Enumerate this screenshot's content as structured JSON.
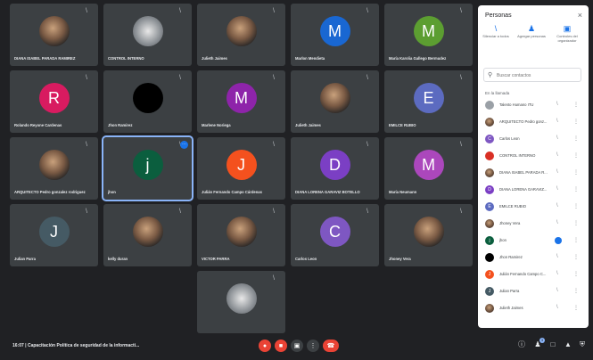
{
  "participants_grid": [
    {
      "name": "DIANA ISABEL PARADA RAMIREZ",
      "avatar": "",
      "kind": "photo",
      "color": ""
    },
    {
      "name": "CONTROL INTERNO",
      "avatar": "",
      "kind": "logo",
      "color": ""
    },
    {
      "name": "Julieth Jaimes",
      "avatar": "",
      "kind": "photo",
      "color": ""
    },
    {
      "name": "Marlon Mendieta",
      "avatar": "M",
      "kind": "letter",
      "color": "#1967d2"
    },
    {
      "name": "María Karolia Gallego Bermudez",
      "avatar": "M",
      "kind": "letter",
      "color": "#5c9e31"
    },
    {
      "name": "Rolando Reyone Cardenas",
      "avatar": "R",
      "kind": "letter",
      "color": "#d81b60"
    },
    {
      "name": "Jhon Ramirez",
      "avatar": "",
      "kind": "dark",
      "color": "#000000"
    },
    {
      "name": "Marlene Noriega",
      "avatar": "M",
      "kind": "letter",
      "color": "#8e24aa"
    },
    {
      "name": "Julieth Jaimes",
      "avatar": "",
      "kind": "photo",
      "color": ""
    },
    {
      "name": "EMILCE RUBIO",
      "avatar": "E",
      "kind": "letter",
      "color": "#5c6bc0"
    },
    {
      "name": "ARQUITECTO Pedro gonzalez rodriguez",
      "avatar": "",
      "kind": "photo",
      "color": ""
    },
    {
      "name": "jhon",
      "avatar": "j",
      "kind": "letter",
      "color": "#0b5e3e"
    },
    {
      "name": "Julián Fernando Campo Cárdenas",
      "avatar": "J",
      "kind": "letter",
      "color": "#f4511e"
    },
    {
      "name": "DIANA LORENA GARAVIZ BOTELLO",
      "avatar": "D",
      "kind": "letter",
      "color": "#7b3fc4"
    },
    {
      "name": "María Neumann",
      "avatar": "M",
      "kind": "letter",
      "color": "#ab47bc"
    },
    {
      "name": "Julian Parra",
      "avatar": "J",
      "kind": "letter",
      "color": "#455a64"
    },
    {
      "name": "kelly duran",
      "avatar": "",
      "kind": "photo",
      "color": ""
    },
    {
      "name": "VICTOR PARRA",
      "avatar": "",
      "kind": "photo",
      "color": ""
    },
    {
      "name": "Carlos Leon",
      "avatar": "C",
      "kind": "letter",
      "color": "#7e57c2"
    },
    {
      "name": "Jhoney Vera",
      "avatar": "",
      "kind": "photo",
      "color": ""
    },
    {
      "name": "",
      "avatar": "",
      "kind": "logo",
      "color": ""
    }
  ],
  "bottom": {
    "meeting_info": "16:07  |  Capacitación Política de seguridad de la informacti...",
    "notification_count": "3"
  },
  "panel": {
    "title": "Personas",
    "actions": [
      {
        "label": "Silenciar a todos",
        "icon": "mic-off-icon"
      },
      {
        "label": "Agregar personas",
        "icon": "add-person-icon"
      },
      {
        "label": "Controles del organizador",
        "icon": "host-controls-icon"
      }
    ],
    "search_placeholder": "Buscar contactos",
    "section_label": "En la llamada",
    "people": [
      {
        "name": "Talento Humano ITU",
        "avatar": "",
        "color": "#9aa0a6"
      },
      {
        "name": "ARQUITECTO Pedro gonz...",
        "avatar": "",
        "color": "photo"
      },
      {
        "name": "Carlos Leon",
        "avatar": "C",
        "color": "#7e57c2"
      },
      {
        "name": "CONTROL INTERNO",
        "avatar": "",
        "color": "#d93025"
      },
      {
        "name": "DIANA ISABEL PARADA R...",
        "avatar": "",
        "color": "photo"
      },
      {
        "name": "DIANA LORENA GARAVIZ...",
        "avatar": "D",
        "color": "#7b3fc4"
      },
      {
        "name": "EMILCE RUBIO",
        "avatar": "E",
        "color": "#5c6bc0"
      },
      {
        "name": "Jhoney Vera",
        "avatar": "",
        "color": "photo"
      },
      {
        "name": "jhon",
        "avatar": "j",
        "color": "#0b5e3e"
      },
      {
        "name": "Jhon Ramirez",
        "avatar": "",
        "color": "#000000"
      },
      {
        "name": "Julián Fernando Campo C...",
        "avatar": "J",
        "color": "#f4511e"
      },
      {
        "name": "Julian Parra",
        "avatar": "J",
        "color": "#455a64"
      },
      {
        "name": "Julieth Jaimes",
        "avatar": "",
        "color": "photo"
      }
    ]
  }
}
